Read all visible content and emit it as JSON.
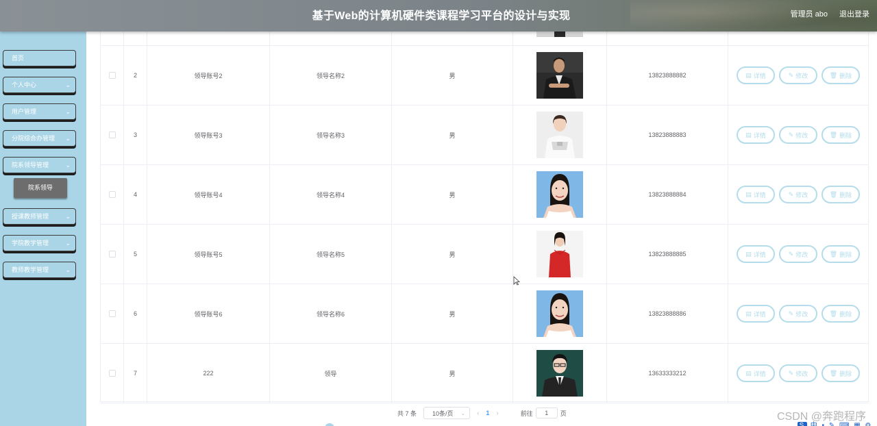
{
  "header": {
    "title": "基于Web的计算机硬件类课程学习平台的设计与实现",
    "user": "管理员 abo",
    "logout": "退出登录"
  },
  "sidebar": {
    "items": [
      {
        "label": "首页",
        "has_arrow": false
      },
      {
        "label": "个人中心",
        "has_arrow": true
      },
      {
        "label": "用户管理",
        "has_arrow": true
      },
      {
        "label": "分院综合办管理",
        "has_arrow": true
      },
      {
        "label": "院系领导管理",
        "has_arrow": true
      },
      {
        "label": "授课教师管理",
        "has_arrow": true
      },
      {
        "label": "学院教学管理",
        "has_arrow": true
      },
      {
        "label": "教师教学管理",
        "has_arrow": true
      }
    ],
    "active_submenu": "院系领导",
    "arrow_icon": "chevron-down-icon"
  },
  "table": {
    "rows": [
      {
        "index": "2",
        "account": "领导账号2",
        "name": "领导名称2",
        "gender": "男",
        "phone": "13823888882",
        "photo": "man-suit-dark"
      },
      {
        "index": "3",
        "account": "领导账号3",
        "name": "领导名称3",
        "gender": "男",
        "phone": "13823888883",
        "photo": "woman-white"
      },
      {
        "index": "4",
        "account": "领导账号4",
        "name": "领导名称4",
        "gender": "男",
        "phone": "13823888884",
        "photo": "woman-blue-bg"
      },
      {
        "index": "5",
        "account": "领导账号5",
        "name": "领导名称5",
        "gender": "男",
        "phone": "13823888885",
        "photo": "woman-red"
      },
      {
        "index": "6",
        "account": "领导账号6",
        "name": "领导名称6",
        "gender": "男",
        "phone": "13823888886",
        "photo": "woman-blue-bg"
      },
      {
        "index": "7",
        "account": "222",
        "name": "领导",
        "gender": "男",
        "phone": "13633333212",
        "photo": "man-suit-green"
      }
    ],
    "actions": {
      "detail": "详情",
      "edit": "修改",
      "delete": "删除"
    }
  },
  "pagination": {
    "total": "共 7 条",
    "page_size": "10条/页",
    "current_page": "1",
    "goto_label": "前往",
    "goto_value": "1",
    "page_suffix": "页"
  },
  "watermark": "CSDN @奔跑程序",
  "colors": {
    "sidebar_bg": "#a9d5e6",
    "header_bg": "#7b8388",
    "action_border": "#b4dcea",
    "active_page": "#409eff"
  }
}
